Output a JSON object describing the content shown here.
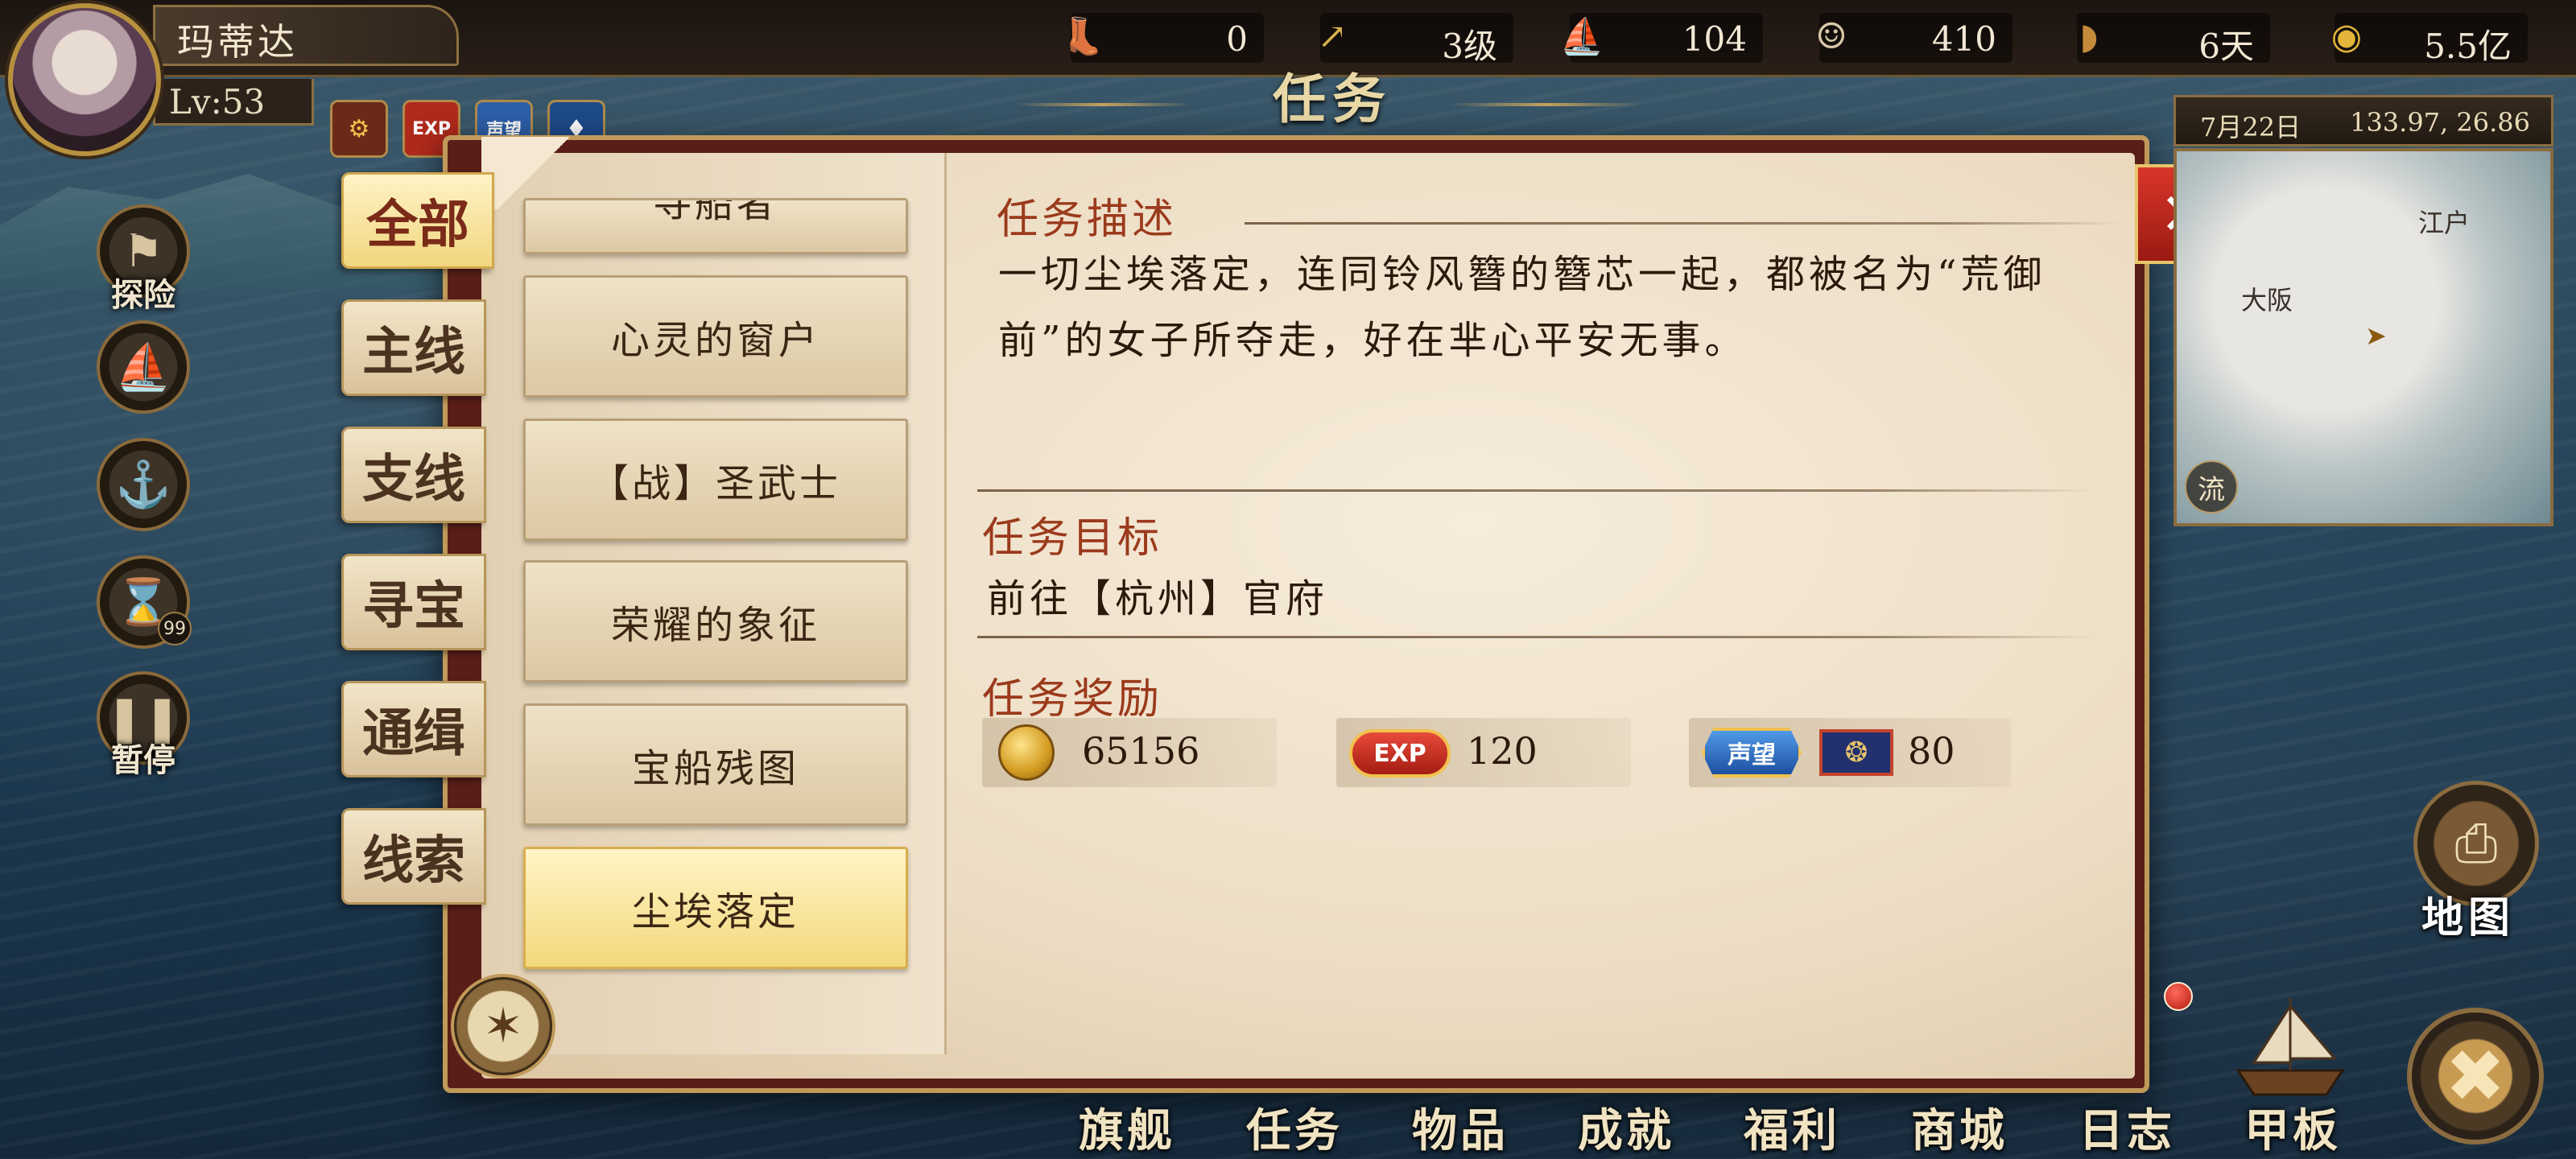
{
  "player": {
    "name": "玛蒂达",
    "level": "Lv:53"
  },
  "resources": [
    {
      "icon": "boot-icon",
      "value": "0"
    },
    {
      "icon": "arrow-up-icon",
      "value": "3级"
    },
    {
      "icon": "ship-icon",
      "value": "104"
    },
    {
      "icon": "sailor-icon",
      "value": "410"
    },
    {
      "icon": "bread-icon",
      "value": "6天"
    },
    {
      "icon": "gold-coin-icon",
      "value": "5.5亿"
    }
  ],
  "mini_buttons": [
    "settings-icon",
    "EXP",
    "声望",
    "potion-icon"
  ],
  "side_buttons": [
    {
      "icon": "flag-icon",
      "label": "探险"
    },
    {
      "icon": "ship-icon",
      "label": ""
    },
    {
      "icon": "anchor-icon",
      "label": ""
    },
    {
      "icon": "hourglass-icon",
      "label": "",
      "badge": "99"
    },
    {
      "icon": "pause-icon",
      "label": "暂停"
    }
  ],
  "title": "任务",
  "categories": [
    "全部",
    "主线",
    "支线",
    "寻宝",
    "通缉",
    "线索"
  ],
  "active_category": "全部",
  "quests": [
    "寻船者",
    "心灵的窗户",
    "【战】圣武士",
    "荣耀的象征",
    "宝船残图",
    "尘埃落定"
  ],
  "active_quest": "尘埃落定",
  "detail": {
    "desc_title": "任务描述",
    "desc_text": "一切尘埃落定，连同铃风簪的簪芯一起，都被名为“荒御前”的女子所夺走，好在芈心平安无事。",
    "goal_title": "任务目标",
    "goal_text": "前往【杭州】官府",
    "reward_title": "任务奖励",
    "rewards": [
      {
        "type": "gold",
        "value": "65156"
      },
      {
        "type": "exp",
        "badge": "EXP",
        "value": "120"
      },
      {
        "type": "reputation",
        "badge": "声望",
        "value": "80"
      }
    ]
  },
  "minimap": {
    "date": "7月22日",
    "coords": "133.97, 26.86",
    "places": [
      "江户",
      "大阪"
    ],
    "flow_label": "流"
  },
  "map_button_label": "地图",
  "bottom_tabs": [
    "旗舰",
    "任务",
    "物品",
    "成就",
    "福利",
    "商城",
    "日志",
    "甲板"
  ],
  "colors": {
    "accent_red": "#9b3a1c",
    "gold": "#c09a5a",
    "panel_frame": "#5a1e18"
  }
}
